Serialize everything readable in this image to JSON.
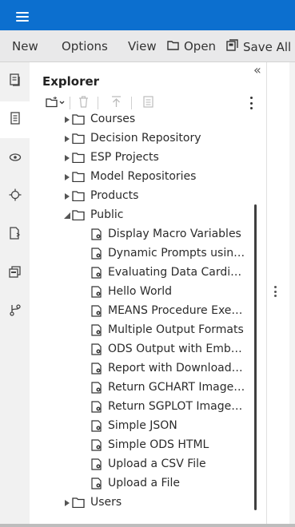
{
  "menubar": {
    "new_label": "New",
    "options_label": "Options",
    "view_label": "View",
    "open_label": "Open",
    "saveall_label": "Save All"
  },
  "explorer": {
    "title": "Explorer",
    "collapse_glyph": "«"
  },
  "tree": {
    "items": [
      {
        "label": "Courses",
        "kind": "folder",
        "expanded": false
      },
      {
        "label": "Decision Repository",
        "kind": "folder",
        "expanded": false
      },
      {
        "label": "ESP Projects",
        "kind": "folder",
        "expanded": false
      },
      {
        "label": "Model Repositories",
        "kind": "folder",
        "expanded": false
      },
      {
        "label": "Products",
        "kind": "folder",
        "expanded": false
      },
      {
        "label": "Public",
        "kind": "folder",
        "expanded": true
      },
      {
        "label": "Display Macro Variables",
        "kind": "file"
      },
      {
        "label": "Dynamic Prompts using ...",
        "kind": "file"
      },
      {
        "label": "Evaluating Data Cardina...",
        "kind": "file"
      },
      {
        "label": "Hello World",
        "kind": "file"
      },
      {
        "label": "MEANS Procedure Exec...",
        "kind": "file"
      },
      {
        "label": "Multiple Output Formats",
        "kind": "file"
      },
      {
        "label": "ODS Output with Embe...",
        "kind": "file"
      },
      {
        "label": "Report with Download L...",
        "kind": "file"
      },
      {
        "label": "Return GCHART Image ...",
        "kind": "file"
      },
      {
        "label": "Return SGPLOT Image ...",
        "kind": "file"
      },
      {
        "label": "Simple JSON",
        "kind": "file"
      },
      {
        "label": "Simple ODS HTML",
        "kind": "file"
      },
      {
        "label": "Upload a CSV File",
        "kind": "file"
      },
      {
        "label": "Upload a File",
        "kind": "file"
      },
      {
        "label": "Users",
        "kind": "folder",
        "expanded": false
      }
    ]
  },
  "colors": {
    "topbar": "#0c6fcf",
    "menubar": "#e9e9ea",
    "leftnav": "#f1f1f1"
  },
  "icons": {
    "nav": [
      "document-icon",
      "program-icon",
      "tasks-icon",
      "snippets-icon",
      "libraries-icon",
      "file-references-icon",
      "git-icon"
    ]
  }
}
